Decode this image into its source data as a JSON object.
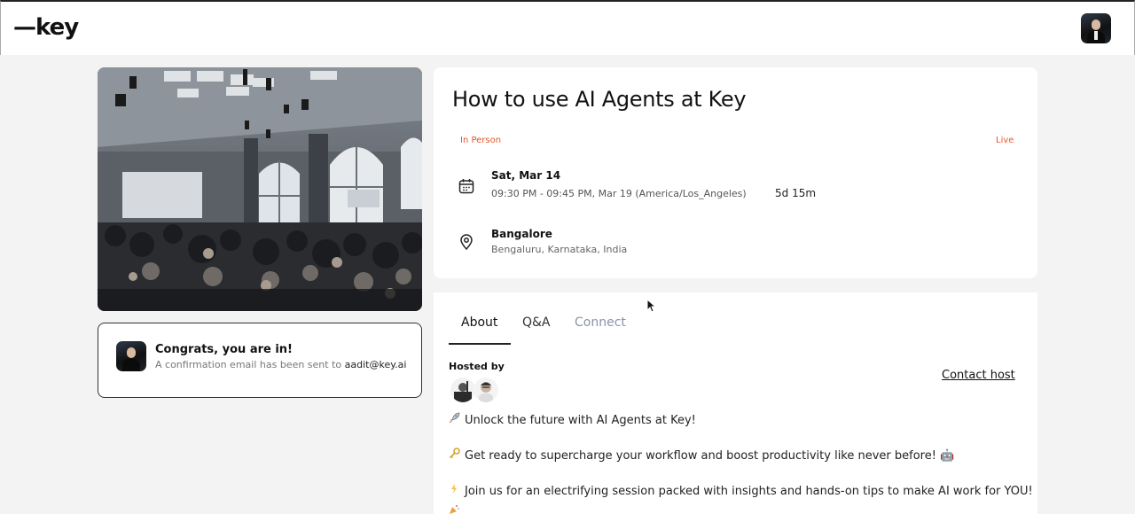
{
  "header": {
    "logo_text": "—key",
    "profile_icon": "user-avatar"
  },
  "congrats": {
    "title": "Congrats, you are in!",
    "subtitle": "A confirmation email has been sent to",
    "email": "aadit@key.ai"
  },
  "event": {
    "title": "How to use AI Agents at Key",
    "format_badge": "In Person",
    "status_badge": "Live",
    "date": "Sat, Mar 14",
    "time_range": "09:30 PM - 09:45 PM, Mar 19  (America/Los_Angeles)",
    "countdown": "5d 15m",
    "location_name": "Bangalore",
    "location_detail": "Bengaluru, Karnataka, India",
    "status_color": "#e4572e"
  },
  "tabs": {
    "about": "About",
    "qa": "Q&A",
    "connect": "Connect"
  },
  "about": {
    "hosted_by": "Hosted by",
    "contact_host": "Contact host",
    "lines": [
      {
        "icon": "rocket",
        "text": "Unlock the future with AI Agents at Key!"
      },
      {
        "icon": "key",
        "text": "Get ready to supercharge your workflow and boost productivity like never before! 🤖"
      },
      {
        "icon": "lightning",
        "text": "Join us for an electrifying session packed with insights and hands-on tips to make AI work for YOU!"
      }
    ]
  }
}
